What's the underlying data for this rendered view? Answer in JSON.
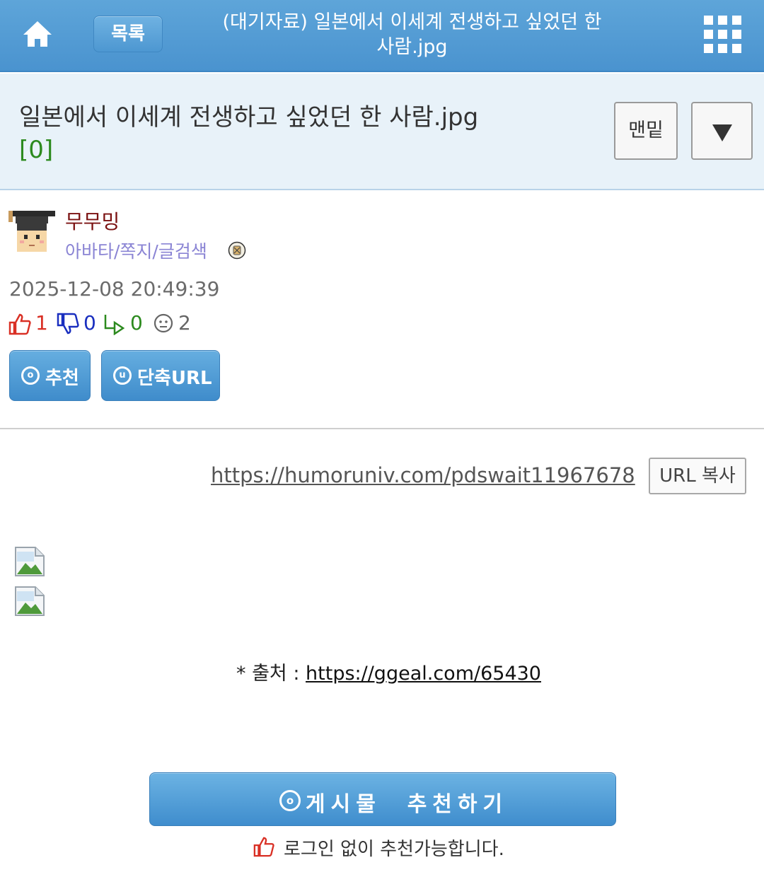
{
  "header": {
    "home_icon": "home-icon",
    "list_label": "목록",
    "title": "(대기자료) 일본에서 이세계 전생하고 싶었던 한 사람.jpg",
    "menu_icon": "grid-menu-icon"
  },
  "post": {
    "title": "일본에서 이세계 전생하고 싶었던 한 사람.jpg",
    "comment_count": "[0]",
    "bottom_label": "맨밑",
    "dropdown_icon": "triangle-down-icon"
  },
  "author": {
    "name": "무무밍",
    "links": "아바타/쪽지/글검색",
    "date": "2025-12-08 20:49:39"
  },
  "stats": {
    "up": "1",
    "down": "0",
    "reply": "0",
    "views": "2"
  },
  "actions": {
    "recommend_label": "추천",
    "recommend_badge": "o",
    "shorturl_label": "단축URL",
    "shorturl_badge": "u"
  },
  "content": {
    "permalink": "https://humoruniv.com/pdswait11967678",
    "copy_label": "URL 복사",
    "source_prefix": "* 출처 : ",
    "source_url": "https://ggeal.com/65430"
  },
  "footer": {
    "recommend_big_label": "게시물  추천하기",
    "recommend_big_badge": "o",
    "nologin_text": "로그인 없이 추천가능합니다."
  },
  "colors": {
    "header_blue": "#4a93cf",
    "panel_bg": "#e8f2f9",
    "author_name": "#7a1010",
    "links_purple": "#8a84d4",
    "up_red": "#d93025",
    "down_blue": "#1a2fbf",
    "reply_green": "#2c8a1e"
  }
}
